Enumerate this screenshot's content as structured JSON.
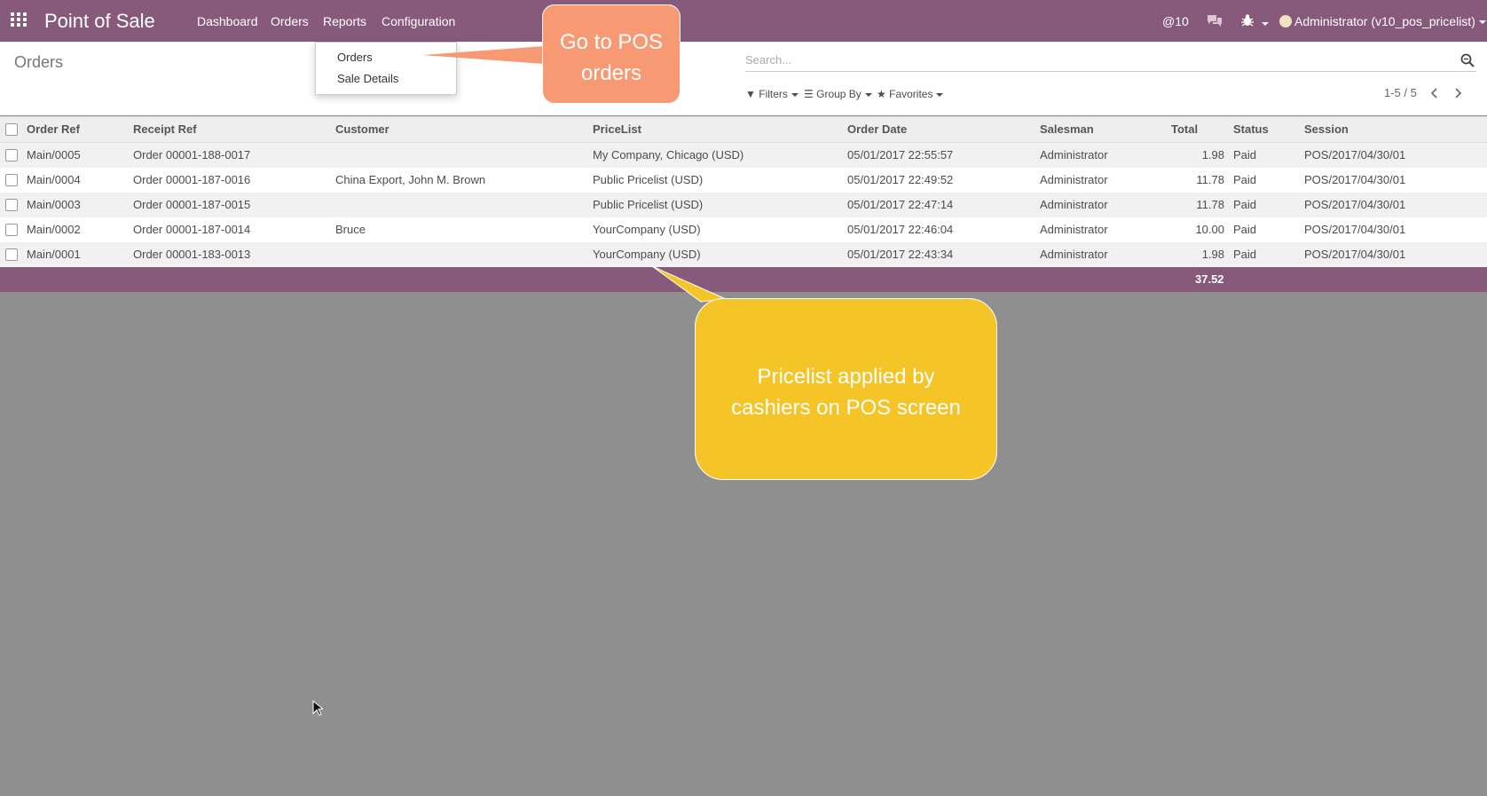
{
  "navbar": {
    "brand": "Point of Sale",
    "menu": [
      "Dashboard",
      "Orders",
      "Reports",
      "Configuration"
    ],
    "mentions": "@10",
    "user": "Administrator (v10_pos_pricelist)"
  },
  "dropdown": {
    "items": [
      "Orders",
      "Sale Details"
    ]
  },
  "control": {
    "breadcrumb": "Orders",
    "search_placeholder": "Search...",
    "filters": "Filters",
    "group_by": "Group By",
    "favorites": "Favorites",
    "pager": "1-5 / 5"
  },
  "table": {
    "columns": [
      "Order Ref",
      "Receipt Ref",
      "Customer",
      "PriceList",
      "Order Date",
      "Salesman",
      "Total",
      "Status",
      "Session"
    ],
    "rows": [
      {
        "order_ref": "Main/0005",
        "receipt_ref": "Order 00001-188-0017",
        "customer": "",
        "pricelist": "My Company, Chicago (USD)",
        "date": "05/01/2017 22:55:57",
        "salesman": "Administrator",
        "total": "1.98",
        "status": "Paid",
        "session": "POS/2017/04/30/01"
      },
      {
        "order_ref": "Main/0004",
        "receipt_ref": "Order 00001-187-0016",
        "customer": "China Export, John M. Brown",
        "pricelist": "Public Pricelist (USD)",
        "date": "05/01/2017 22:49:52",
        "salesman": "Administrator",
        "total": "11.78",
        "status": "Paid",
        "session": "POS/2017/04/30/01"
      },
      {
        "order_ref": "Main/0003",
        "receipt_ref": "Order 00001-187-0015",
        "customer": "",
        "pricelist": "Public Pricelist (USD)",
        "date": "05/01/2017 22:47:14",
        "salesman": "Administrator",
        "total": "11.78",
        "status": "Paid",
        "session": "POS/2017/04/30/01"
      },
      {
        "order_ref": "Main/0002",
        "receipt_ref": "Order 00001-187-0014",
        "customer": "Bruce",
        "pricelist": "YourCompany (USD)",
        "date": "05/01/2017 22:46:04",
        "salesman": "Administrator",
        "total": "10.00",
        "status": "Paid",
        "session": "POS/2017/04/30/01"
      },
      {
        "order_ref": "Main/0001",
        "receipt_ref": "Order 00001-183-0013",
        "customer": "",
        "pricelist": "YourCompany (USD)",
        "date": "05/01/2017 22:43:34",
        "salesman": "Administrator",
        "total": "1.98",
        "status": "Paid",
        "session": "POS/2017/04/30/01"
      }
    ],
    "footer_total": "37.52"
  },
  "callouts": {
    "orange": [
      "Go to POS",
      "orders"
    ],
    "yellow": [
      "Pricelist applied by",
      "cashiers on POS screen"
    ]
  },
  "colors": {
    "brand": "#875a7b",
    "orange_callout": "#f79a74",
    "yellow_callout": "#f5c427",
    "backdrop": "#8f8f8f"
  }
}
